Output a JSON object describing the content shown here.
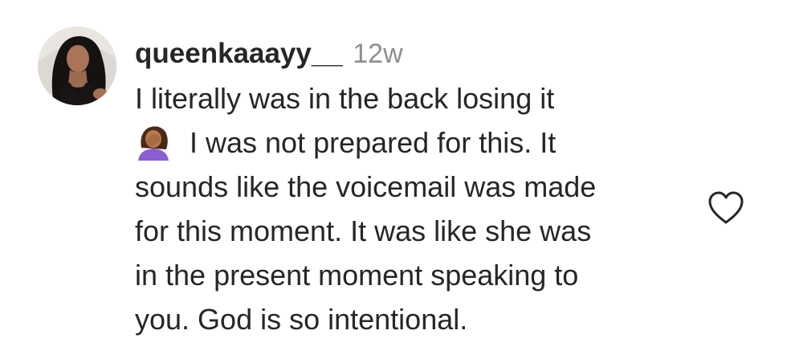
{
  "comment": {
    "username": "queenkaaayy__",
    "timestamp": "12w",
    "text_lines": [
      "I literally was in the back losing it",
      "I was not prepared for this. It",
      "sounds like the voicemail was made",
      "for this moment. It was like she was",
      "in the present moment speaking to",
      "you. God is so intentional."
    ],
    "emoji": "face-palm-emoji"
  },
  "icons": {
    "like": "heart-icon",
    "avatar": "profile-avatar"
  },
  "colors": {
    "text": "#262626",
    "secondary": "#8e8e8e",
    "background": "#ffffff"
  }
}
